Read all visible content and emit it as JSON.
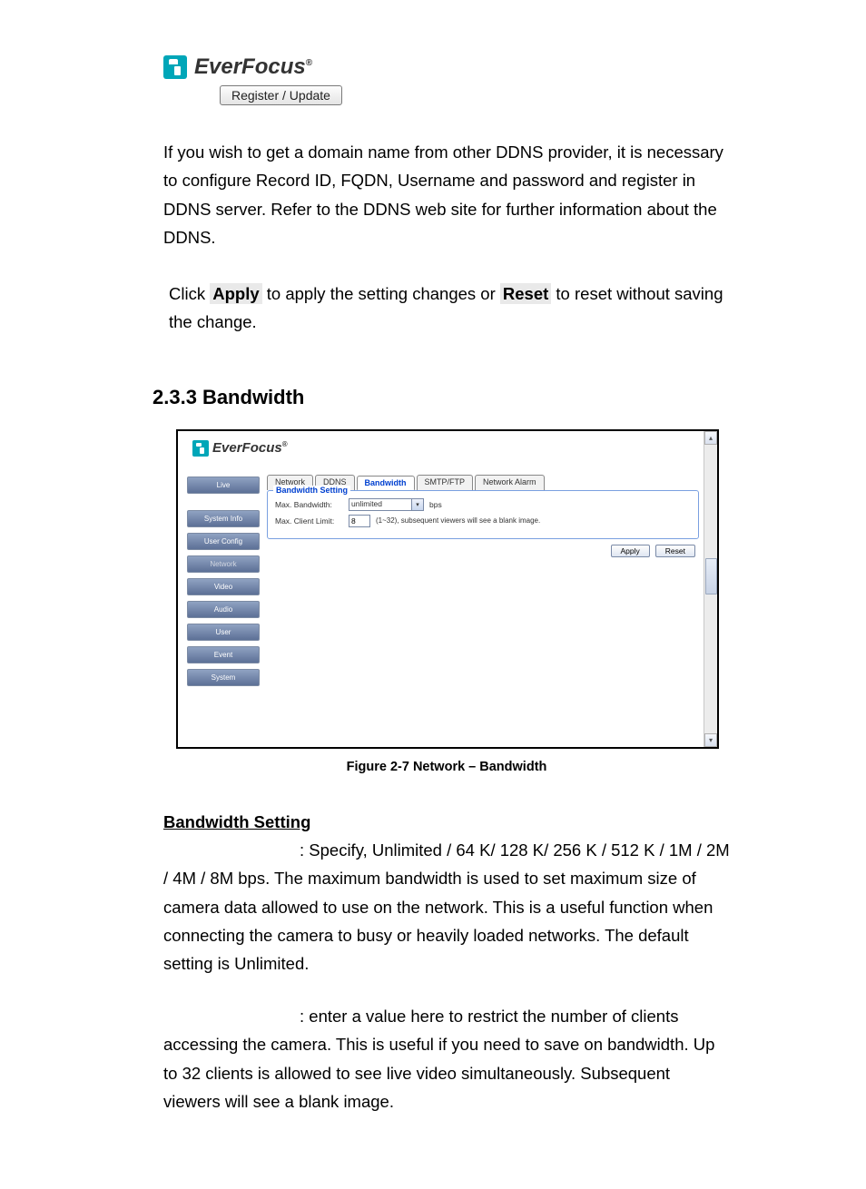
{
  "logo": {
    "brand": "EverFocus",
    "reg_mark": "®"
  },
  "register_button": "Register / Update",
  "intro_para": "If you wish to get a domain name from other DDNS provider, it is necessary to configure Record ID, FQDN, Username and password and register in DDNS server. Refer to the DDNS web site for further information about the DDNS.",
  "apply_para_pre": "Click ",
  "apply_word": "Apply",
  "apply_para_mid": " to apply the setting changes or ",
  "reset_word": "Reset",
  "apply_para_post": " to reset without saving the change.",
  "section": {
    "num": "2.3.3",
    "title": "Bandwidth"
  },
  "figure_caption": "Figure 2-7 Network – Bandwidth",
  "screenshot": {
    "brand": "EverFocus",
    "reg_mark": "®",
    "sidebar": {
      "live": "Live",
      "system_info": "System Info",
      "user_config": "User Config",
      "network": "Network",
      "video": "Video",
      "audio": "Audio",
      "user": "User",
      "event": "Event",
      "system": "System"
    },
    "tabs": {
      "network": "Network",
      "ddns": "DDNS",
      "bandwidth": "Bandwidth",
      "smtp": "SMTP/FTP",
      "alarm": "Network Alarm"
    },
    "fieldset_title": "Bandwidth Setting",
    "max_bandwidth_label": "Max. Bandwidth:",
    "max_bandwidth_value": "unlimited",
    "bps": "bps",
    "max_client_label": "Max. Client Limit:",
    "max_client_value": "8",
    "client_hint": "(1~32), subsequent viewers will see a blank image.",
    "apply": "Apply",
    "reset": "Reset"
  },
  "subheading": "Bandwidth Setting",
  "para_bandwidth": ": Specify, Unlimited / 64 K/ 128 K/ 256 K / 512 K / 1M / 2M / 4M / 8M bps. The maximum bandwidth is used to set maximum size of camera data allowed to use on the network. This is a useful function when connecting the camera to busy or heavily loaded networks. The default setting is Unlimited.",
  "para_client": ": enter a value here to restrict the number of clients accessing the camera. This is useful if you need to save on bandwidth. Up to 32 clients is allowed to see live video simultaneously. Subsequent viewers will see a blank image."
}
